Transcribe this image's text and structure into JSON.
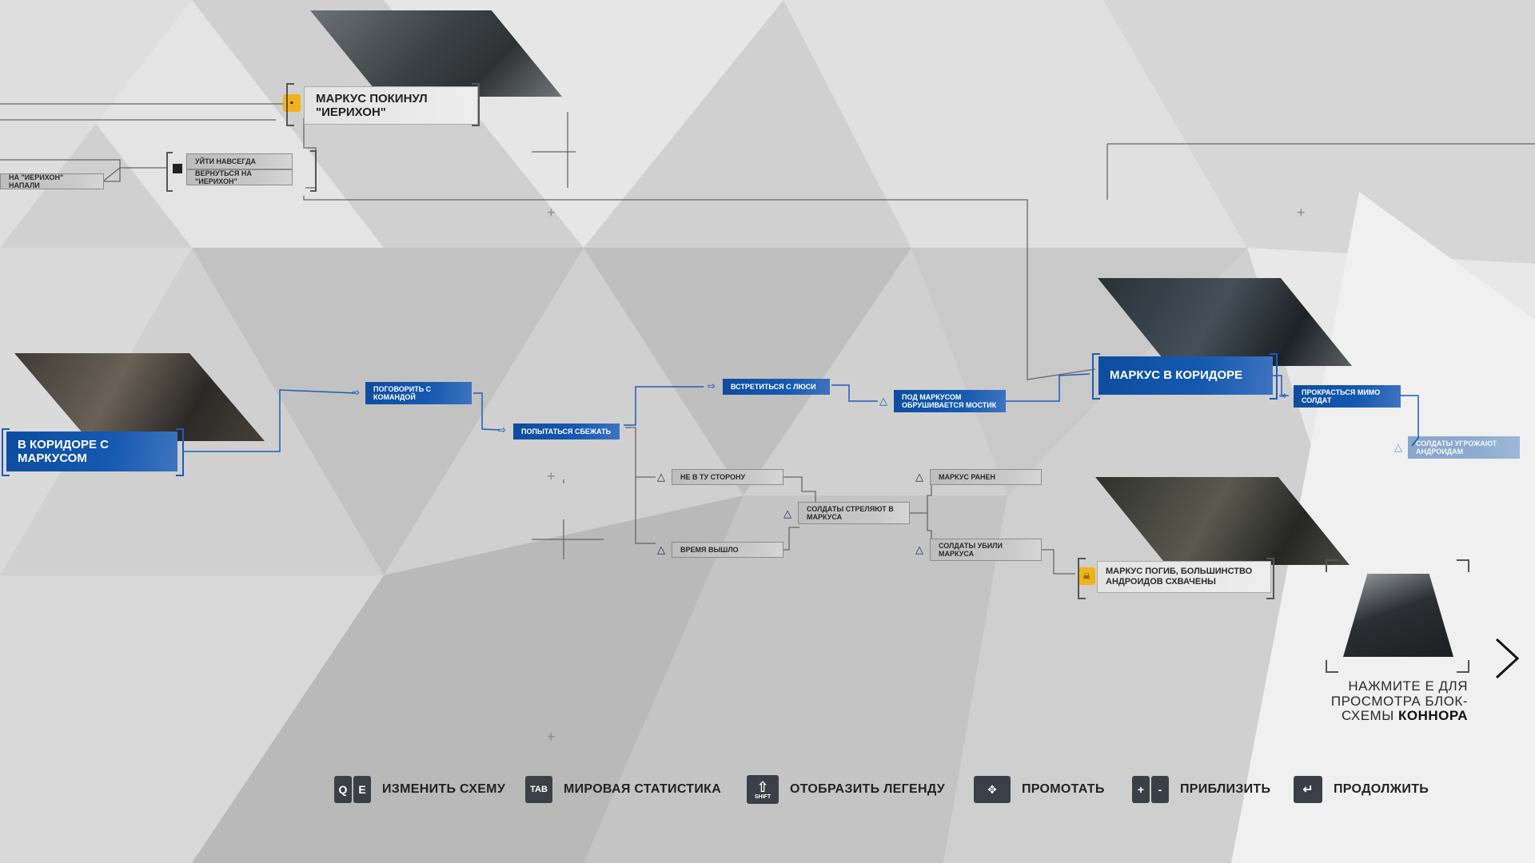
{
  "nodes": {
    "marcus_left_jericho": "МАРКУС ПОКИНУЛ \"ИЕРИХОН\"",
    "leave_forever": "УЙТИ НАВСЕГДА",
    "return_jericho": "ВЕРНУТЬСЯ НА \"ИЕРИХОН\"",
    "jericho_attacked": "НА \"ИЕРИХОН\" НАПАЛИ",
    "in_corridor_with_marcus": "В КОРИДОРЕ С МАРКУСОМ",
    "talk_to_team": "ПОГОВОРИТЬ С КОМАНДОЙ",
    "try_escape": "ПОПЫТАТЬСЯ СБЕЖАТЬ",
    "meet_lucy": "ВСТРЕТИТЬСЯ С ЛЮСИ",
    "bridge_collapses": "ПОД МАРКУСОМ ОБРУШИВАЕТСЯ МОСТИК",
    "marcus_in_corridor": "МАРКУС В КОРИДОРЕ",
    "sneak_past_soldiers": "ПРОКРАСТЬСЯ МИМО СОЛДАТ",
    "soldiers_threaten": "СОЛДАТЫ УГРОЖАЮТ АНДРОИДАМ",
    "wrong_way": "НЕ В ТУ СТОРОНУ",
    "time_up": "ВРЕМЯ ВЫШЛО",
    "soldiers_shoot": "СОЛДАТЫ СТРЕЛЯЮТ В МАРКУСА",
    "marcus_wounded": "МАРКУС РАНЕН",
    "soldiers_killed": "СОЛДАТЫ УБИЛИ МАРКУСА",
    "marcus_died": "МАРКУС ПОГИБ, БОЛЬШИНСТВО АНДРОИДОВ СХВАЧЕНЫ"
  },
  "connor": {
    "line1": "НАЖМИТЕ E ДЛЯ",
    "line2": "ПРОСМОТРА БЛОК-",
    "line3": "СХЕМЫ",
    "name": "КОННОРА"
  },
  "footer": {
    "change_keys": [
      "Q",
      "E"
    ],
    "change_label": "ИЗМЕНИТЬ СХЕМУ",
    "tab_key": "TAB",
    "stats_label": "МИРОВАЯ СТАТИСТИКА",
    "shift_key": "SHIFT",
    "legend_label": "ОТОБРАЗИТЬ ЛЕГЕНДУ",
    "scroll_label": "ПРОМОТАТЬ",
    "zoom_keys": [
      "+",
      "-"
    ],
    "zoom_label": "ПРИБЛИЗИТЬ",
    "continue_label": "ПРОДОЛЖИТЬ"
  },
  "colors": {
    "accent_blue": "#1559b0",
    "lock_yellow": "#f2b31a",
    "key_bg": "#3b4048"
  }
}
